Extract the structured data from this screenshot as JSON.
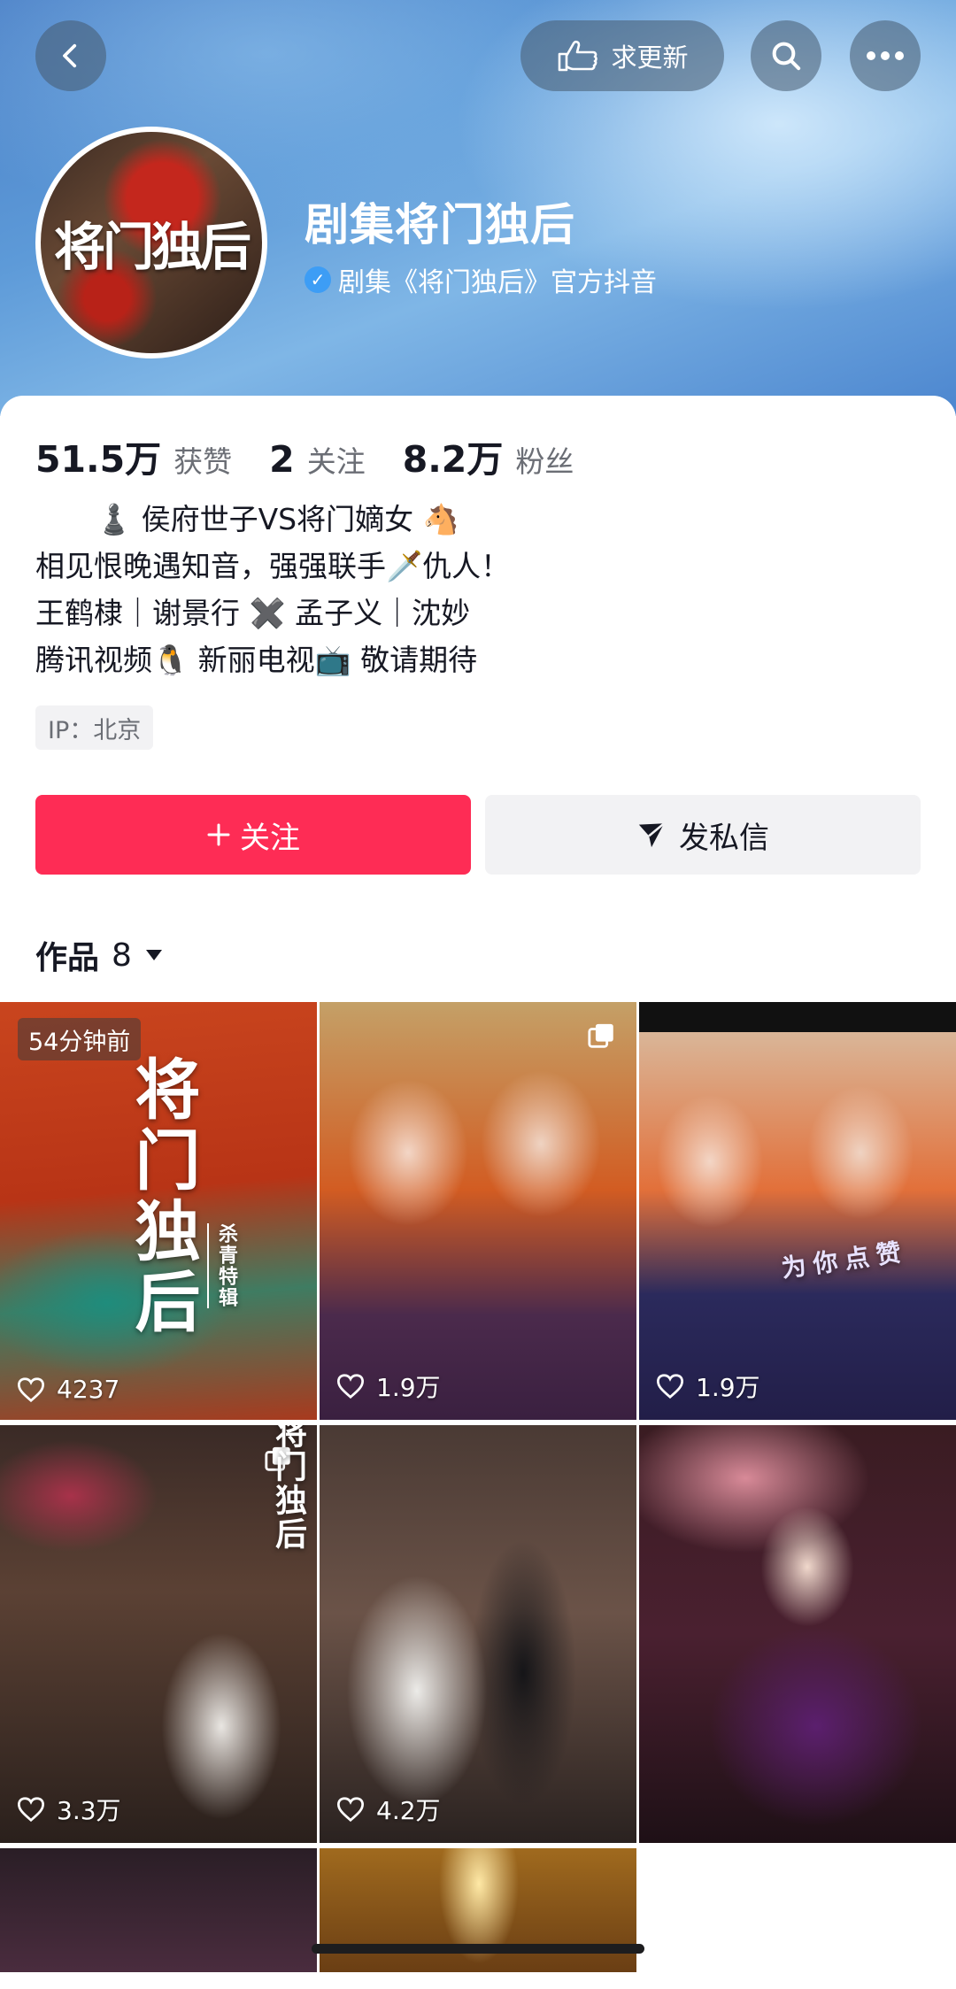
{
  "header": {
    "update_button_label": "求更新"
  },
  "profile": {
    "avatar_text": "将门独后",
    "name": "剧集将门独后",
    "verification": "剧集《将门独后》官方抖音",
    "stats": [
      {
        "value": "51.5万",
        "label": "获赞"
      },
      {
        "value": "2",
        "label": "关注"
      },
      {
        "value": "8.2万",
        "label": "粉丝"
      }
    ],
    "bio": [
      "♟️ 侯府世子VS将门嫡女 🐴",
      "相见恨晚遇知音，强强联手🗡️仇人！",
      "王鹤棣｜谢景行 ✖️ 孟子义｜沈妙",
      "腾讯视频🐧 新丽电视📺 敬请期待"
    ],
    "ip": "IP：北京"
  },
  "actions": {
    "follow_label": "关注",
    "message_label": "发私信"
  },
  "works": {
    "label": "作品",
    "count": "8",
    "items": [
      {
        "likes": "4237",
        "time": "54分钟前",
        "title": "将门独后",
        "subtitle": "杀青特辑"
      },
      {
        "likes": "1.9万"
      },
      {
        "likes": "1.9万",
        "overlay_text": "为你点赞"
      },
      {
        "likes": "3.3万",
        "title": "将门独后"
      },
      {
        "likes": "4.2万"
      },
      {
        "likes": ""
      },
      {
        "likes": ""
      },
      {
        "likes": ""
      }
    ]
  },
  "colors": {
    "primary": "#fe2c55",
    "text": "#161823",
    "secondary_text": "#6b6e75"
  }
}
